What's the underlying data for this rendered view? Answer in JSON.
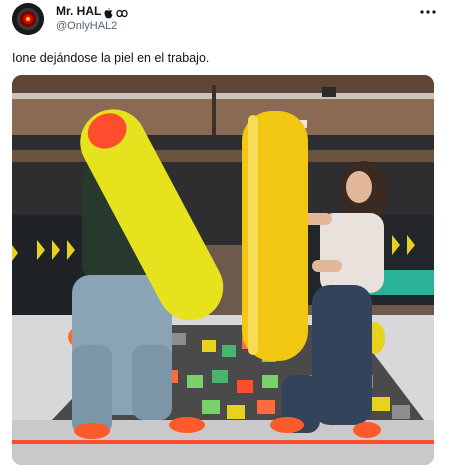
{
  "author": {
    "display_name": "Mr. HAL",
    "emoji_suffix": "🍎➰",
    "handle": "@OnlyHAL2",
    "avatar_icon": "hal-9000-eye-icon"
  },
  "more_icon": "more-horizontal-icon",
  "tweet": {
    "text": "Ione dejándose la piel en el trabajo."
  },
  "media": {
    "icon": "video-thumbnail"
  },
  "colors": {
    "text": "#0f1419",
    "secondary_text": "#536471",
    "foam_yellow": "#e8d21f",
    "tip_red": "#ff4d2e"
  }
}
